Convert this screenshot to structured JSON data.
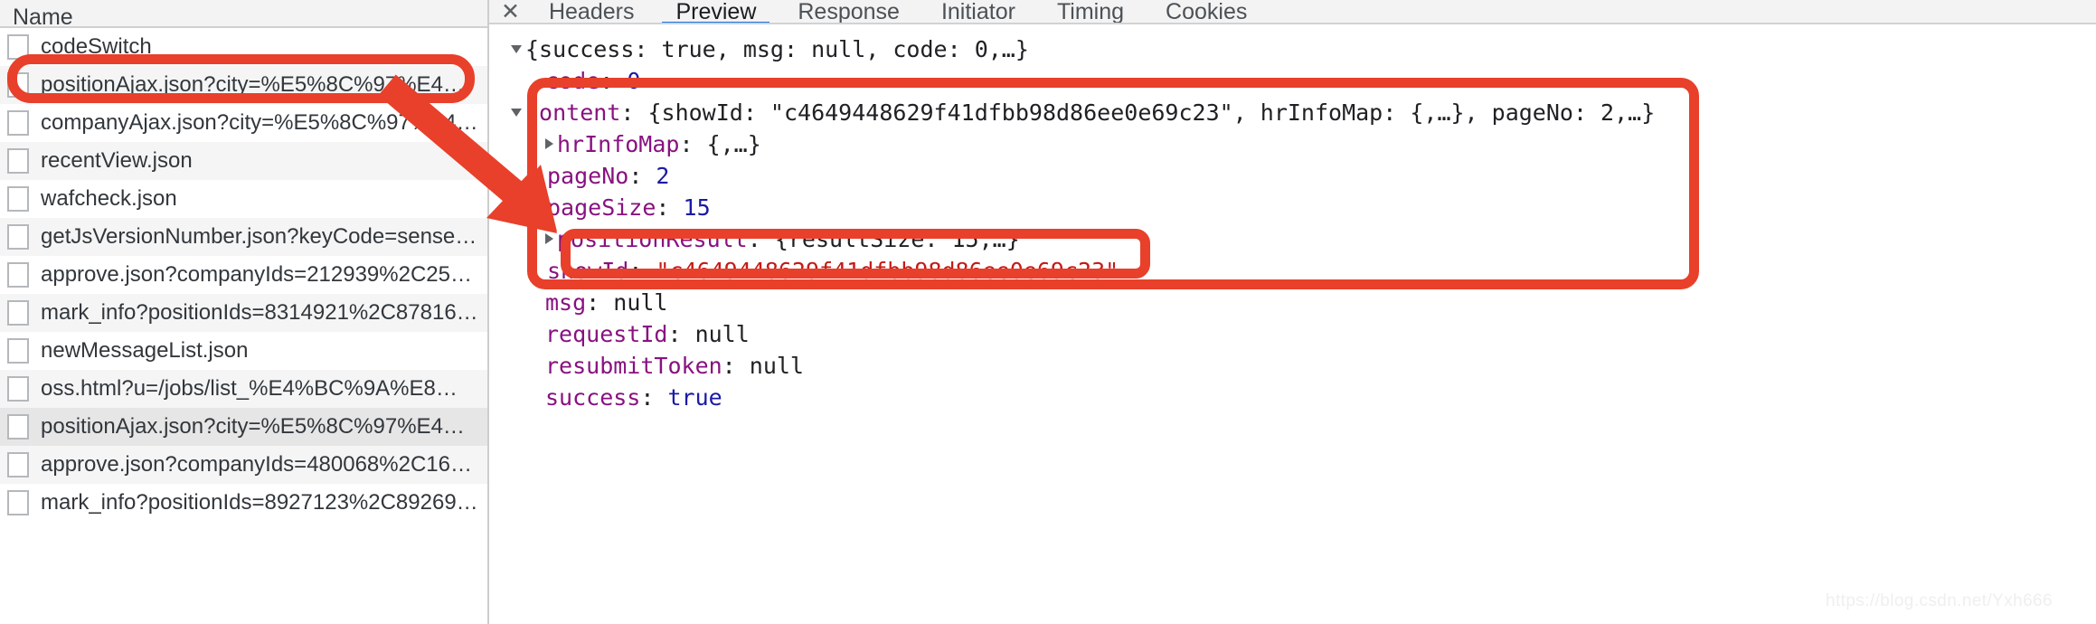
{
  "left_panel": {
    "header": {
      "label": "Name"
    },
    "rows": [
      {
        "label": "codeSwitch",
        "selected": false,
        "icon": "document-icon"
      },
      {
        "label": "positionAjax.json?city=%E5%8C%97%E4…",
        "selected": false,
        "icon": "document-icon"
      },
      {
        "label": "companyAjax.json?city=%E5%8C%97%E4…",
        "selected": false,
        "icon": "document-icon"
      },
      {
        "label": "recentView.json",
        "selected": false,
        "icon": "document-icon"
      },
      {
        "label": "wafcheck.json",
        "selected": false,
        "icon": "document-icon"
      },
      {
        "label": "getJsVersionNumber.json?keyCode=sense…",
        "selected": false,
        "icon": "document-icon"
      },
      {
        "label": "approve.json?companyIds=212939%2C25…",
        "selected": false,
        "icon": "document-icon"
      },
      {
        "label": "mark_info?positionIds=8314921%2C87816…",
        "selected": false,
        "icon": "document-icon"
      },
      {
        "label": "newMessageList.json",
        "selected": false,
        "icon": "document-icon"
      },
      {
        "label": "oss.html?u=/jobs/list_%E4%BC%9A%E8…",
        "selected": false,
        "icon": "document-icon"
      },
      {
        "label": "positionAjax.json?city=%E5%8C%97%E4…",
        "selected": true,
        "icon": "document-icon"
      },
      {
        "label": "approve.json?companyIds=480068%2C16…",
        "selected": false,
        "icon": "document-icon"
      },
      {
        "label": "mark_info?positionIds=8927123%2C89269…",
        "selected": false,
        "icon": "document-icon"
      }
    ]
  },
  "right_panel": {
    "close_glyph": "✕",
    "tabs": [
      {
        "label": "Headers",
        "active": false
      },
      {
        "label": "Preview",
        "active": true
      },
      {
        "label": "Response",
        "active": false
      },
      {
        "label": "Initiator",
        "active": false
      },
      {
        "label": "Timing",
        "active": false
      },
      {
        "label": "Cookies",
        "active": false
      }
    ],
    "json": {
      "root_summary": "{success: true, msg: null, code: 0,…}",
      "line_code_key": "code",
      "line_code_value": "0",
      "content_key": "content",
      "content_summary": "{showId: \"c4649448629f41dfbb98d86ee0e69c23\", hrInfoMap: {,…}, pageNo: 2,…}",
      "hrinfomap_key": "hrInfoMap",
      "hrinfomap_value": "{,…}",
      "pageno_key": "pageNo",
      "pageno_value": "2",
      "pagesize_key": "pageSize",
      "pagesize_value": "15",
      "positionresult_key": "positionResult",
      "positionresult_value": "{resultSize: 15,…}",
      "showid_key": "showId",
      "showid_value": "\"c4649448629f41dfbb98d86ee0e69c23\"",
      "msg_key": "msg",
      "msg_value": "null",
      "requestid_key": "requestId",
      "requestid_value": "null",
      "resubmittoken_key": "resubmitToken",
      "resubmittoken_value": "null",
      "success_key": "success",
      "success_value": "true"
    }
  },
  "annotations": {
    "color": "#e8402a",
    "arrow_name": "red-arrow-pointing-to-showid",
    "boxes": [
      {
        "name": "highlight-box-request-row"
      },
      {
        "name": "highlight-box-content-object"
      },
      {
        "name": "highlight-box-showid-line"
      }
    ]
  },
  "watermark": {
    "text": "https://blog.csdn.net/Yxh666"
  }
}
